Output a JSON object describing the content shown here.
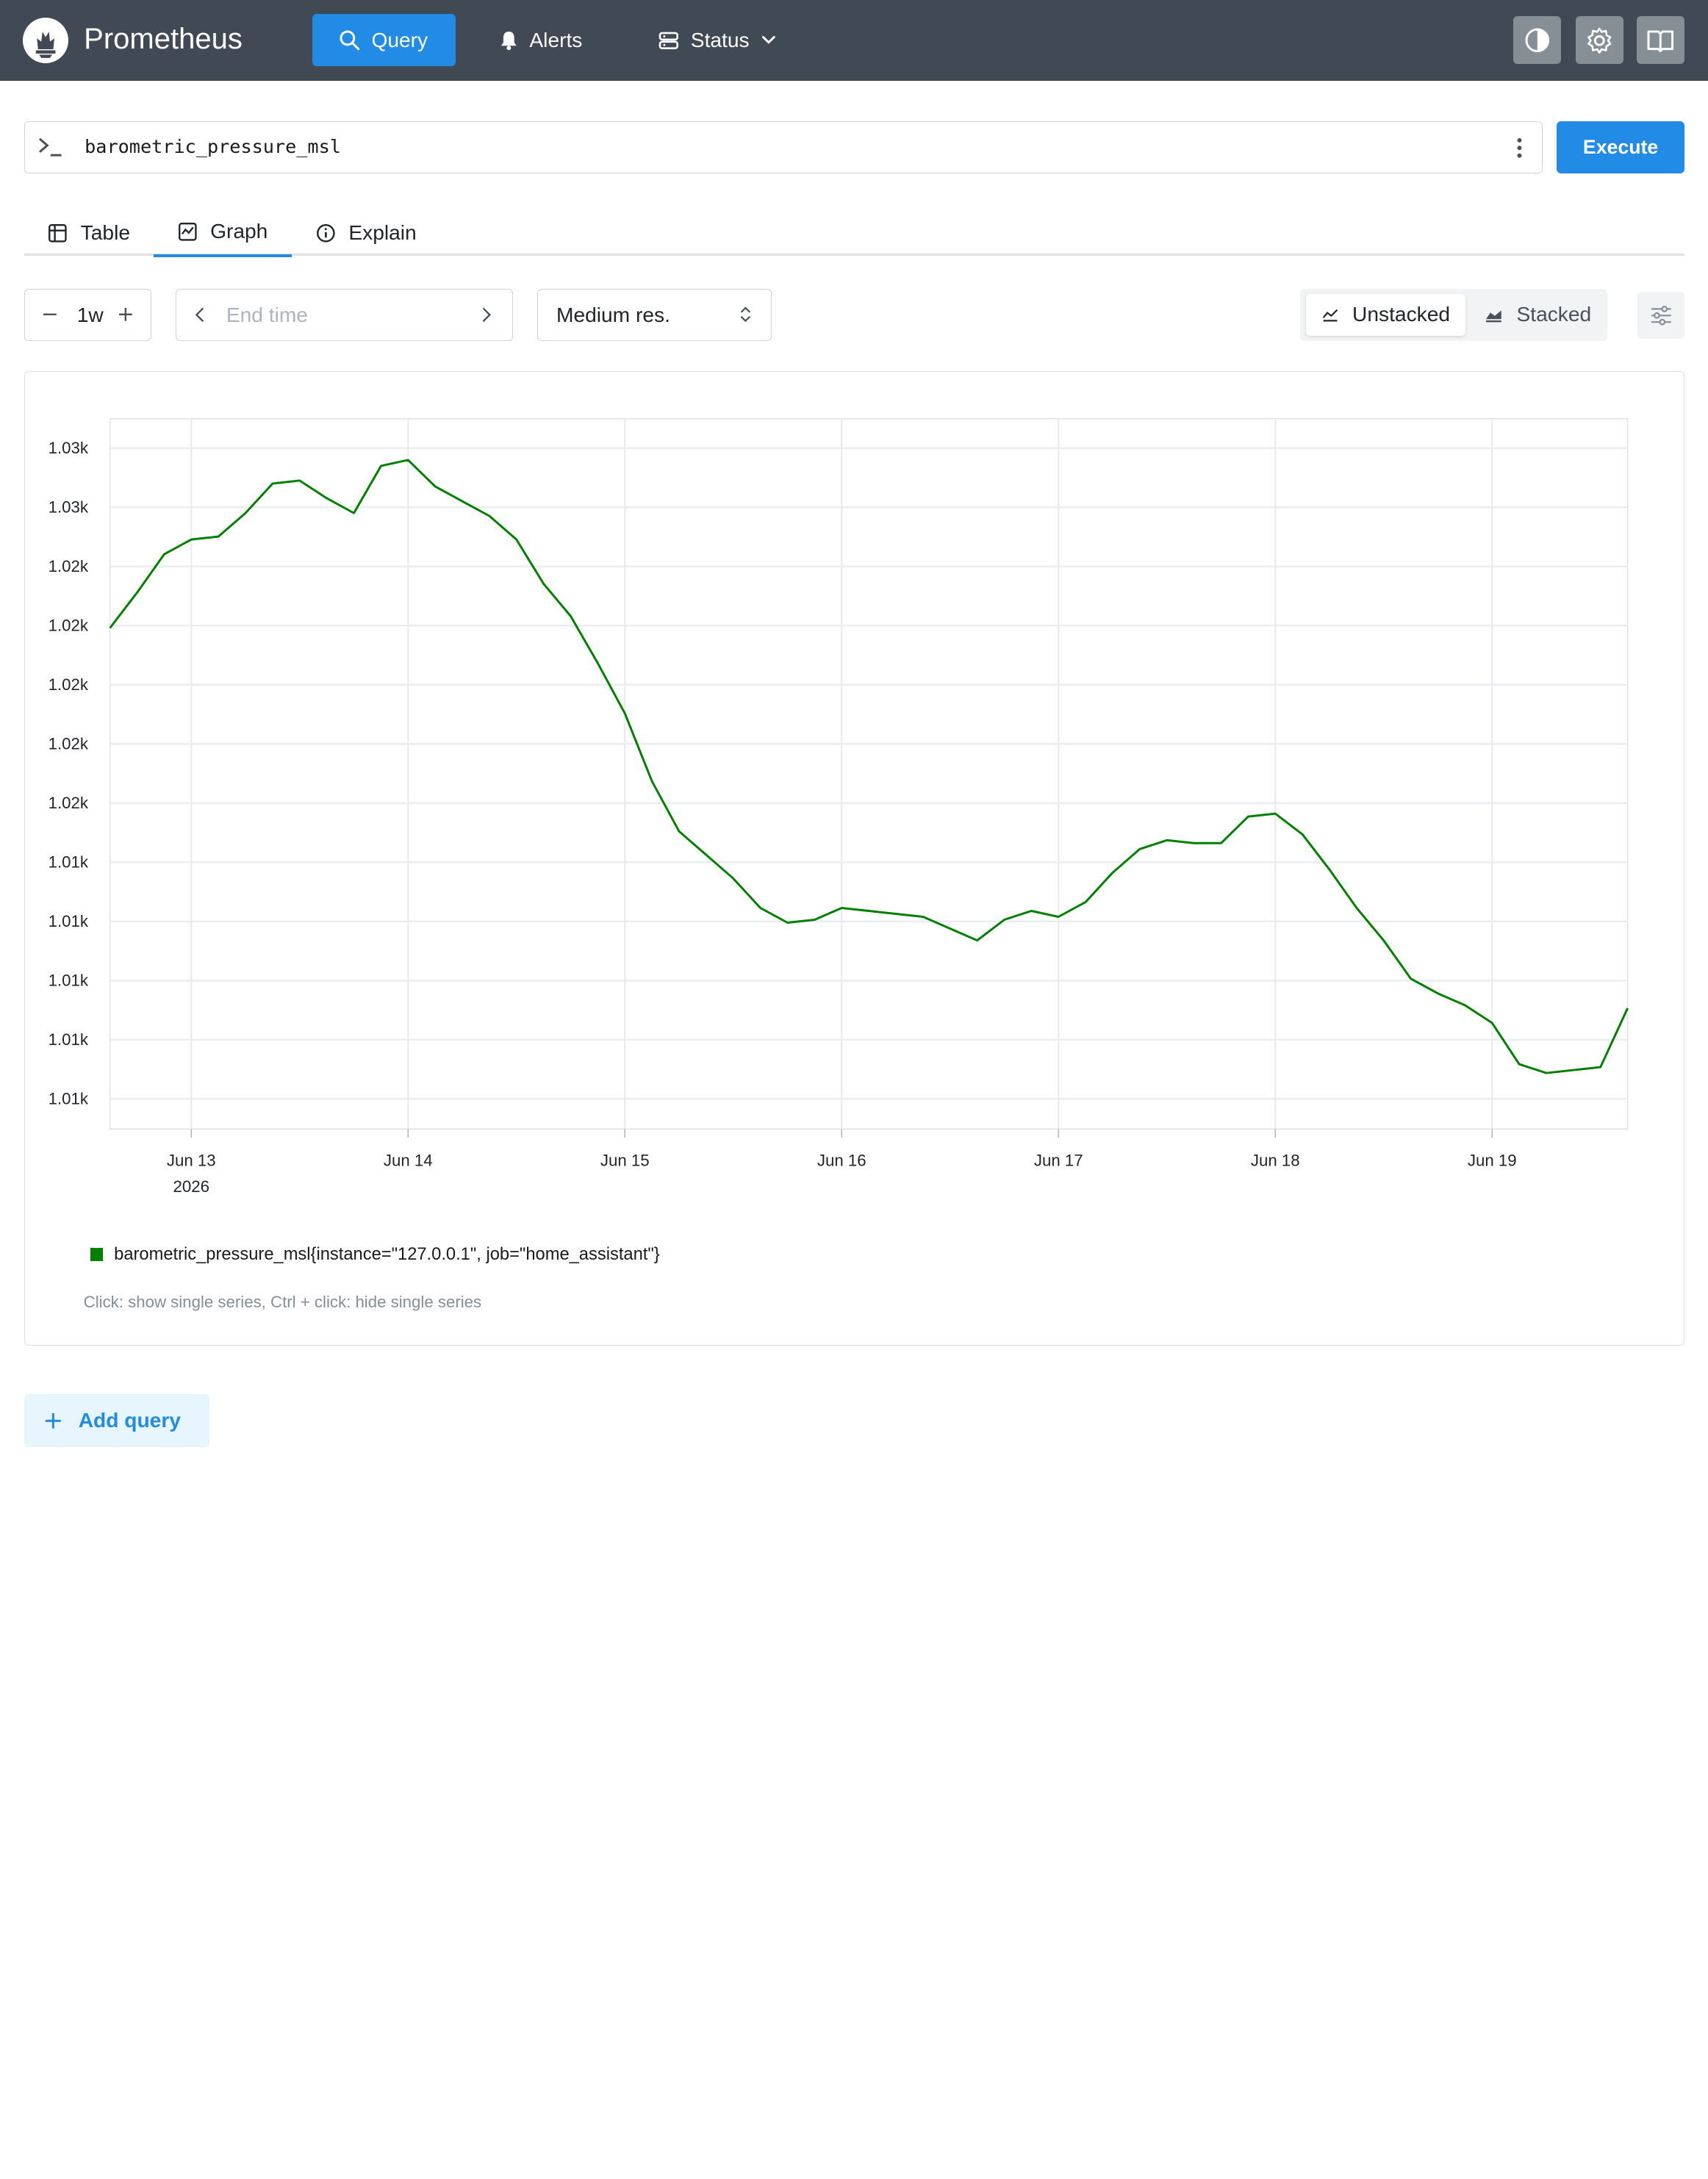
{
  "app": {
    "title": "Prometheus"
  },
  "nav": {
    "query": "Query",
    "alerts": "Alerts",
    "status": "Status"
  },
  "query": {
    "expr": "barometric_pressure_msl",
    "execute": "Execute"
  },
  "tabs": {
    "table": "Table",
    "graph": "Graph",
    "explain": "Explain",
    "active": "Graph"
  },
  "controls": {
    "range": "1w",
    "end_time_placeholder": "End time",
    "resolution": "Medium res.",
    "unstacked": "Unstacked",
    "stacked": "Stacked",
    "active_mode": "Unstacked"
  },
  "chart_data": {
    "type": "line",
    "x_ticks": [
      "Jun 13",
      "Jun 14",
      "Jun 15",
      "Jun 16",
      "Jun 17",
      "Jun 18",
      "Jun 19"
    ],
    "x_year_label": "2026",
    "y_ticks": [
      "1.03k",
      "1.03k",
      "1.02k",
      "1.02k",
      "1.02k",
      "1.02k",
      "1.02k",
      "1.01k",
      "1.01k",
      "1.01k",
      "1.01k",
      "1.01k"
    ],
    "x_range": [
      "2026-06-12 15:00",
      "2026-06-19 15:00"
    ],
    "ylim": [
      1003.6,
      1027.7
    ],
    "grid": true,
    "legend_position": "bottom-left",
    "series": [
      {
        "name": "barometric_pressure_msl{instance=\"127.0.0.1\", job=\"home_assistant\"}",
        "color": "#008000",
        "points": [
          [
            "2026-06-12 15:00",
            1020.6
          ],
          [
            "2026-06-12 18:00",
            1021.8
          ],
          [
            "2026-06-12 21:00",
            1023.1
          ],
          [
            "2026-06-13 00:00",
            1023.6
          ],
          [
            "2026-06-13 03:00",
            1023.7
          ],
          [
            "2026-06-13 06:00",
            1024.5
          ],
          [
            "2026-06-13 09:00",
            1025.5
          ],
          [
            "2026-06-13 12:00",
            1025.6
          ],
          [
            "2026-06-13 15:00",
            1025.0
          ],
          [
            "2026-06-13 18:00",
            1024.5
          ],
          [
            "2026-06-13 21:00",
            1026.1
          ],
          [
            "2026-06-14 00:00",
            1026.3
          ],
          [
            "2026-06-14 03:00",
            1025.4
          ],
          [
            "2026-06-14 06:00",
            1024.9
          ],
          [
            "2026-06-14 09:00",
            1024.4
          ],
          [
            "2026-06-14 12:00",
            1023.6
          ],
          [
            "2026-06-14 15:00",
            1022.1
          ],
          [
            "2026-06-14 18:00",
            1021.0
          ],
          [
            "2026-06-14 21:00",
            1019.4
          ],
          [
            "2026-06-15 00:00",
            1017.7
          ],
          [
            "2026-06-15 03:00",
            1015.4
          ],
          [
            "2026-06-15 06:00",
            1013.7
          ],
          [
            "2026-06-15 09:00",
            1012.9
          ],
          [
            "2026-06-15 12:00",
            1012.1
          ],
          [
            "2026-06-15 15:00",
            1011.1
          ],
          [
            "2026-06-15 18:00",
            1010.6
          ],
          [
            "2026-06-15 21:00",
            1010.7
          ],
          [
            "2026-06-16 00:00",
            1011.1
          ],
          [
            "2026-06-16 03:00",
            1011.0
          ],
          [
            "2026-06-16 06:00",
            1010.9
          ],
          [
            "2026-06-16 09:00",
            1010.8
          ],
          [
            "2026-06-16 12:00",
            1010.4
          ],
          [
            "2026-06-16 15:00",
            1010.0
          ],
          [
            "2026-06-16 18:00",
            1010.7
          ],
          [
            "2026-06-16 21:00",
            1011.0
          ],
          [
            "2026-06-17 00:00",
            1010.8
          ],
          [
            "2026-06-17 03:00",
            1011.3
          ],
          [
            "2026-06-17 06:00",
            1012.3
          ],
          [
            "2026-06-17 09:00",
            1013.1
          ],
          [
            "2026-06-17 12:00",
            1013.4
          ],
          [
            "2026-06-17 15:00",
            1013.3
          ],
          [
            "2026-06-17 18:00",
            1013.3
          ],
          [
            "2026-06-17 21:00",
            1014.2
          ],
          [
            "2026-06-18 00:00",
            1014.3
          ],
          [
            "2026-06-18 03:00",
            1013.6
          ],
          [
            "2026-06-18 06:00",
            1012.4
          ],
          [
            "2026-06-18 09:00",
            1011.1
          ],
          [
            "2026-06-18 12:00",
            1010.0
          ],
          [
            "2026-06-18 15:00",
            1008.7
          ],
          [
            "2026-06-18 18:00",
            1008.2
          ],
          [
            "2026-06-18 21:00",
            1007.8
          ],
          [
            "2026-06-19 00:00",
            1007.2
          ],
          [
            "2026-06-19 03:00",
            1005.8
          ],
          [
            "2026-06-19 06:00",
            1005.5
          ],
          [
            "2026-06-19 09:00",
            1005.6
          ],
          [
            "2026-06-19 12:00",
            1005.7
          ],
          [
            "2026-06-19 15:00",
            1007.7
          ]
        ]
      }
    ]
  },
  "legend_hint": "Click: show single series, Ctrl + click: hide single series",
  "add_query": "Add query",
  "icons": {
    "logo": "prometheus-flame-logo",
    "query": "search-icon",
    "alerts": "bell-icon",
    "status": "server-icon",
    "theme": "contrast-icon",
    "settings": "gear-icon",
    "docs": "book-icon"
  }
}
